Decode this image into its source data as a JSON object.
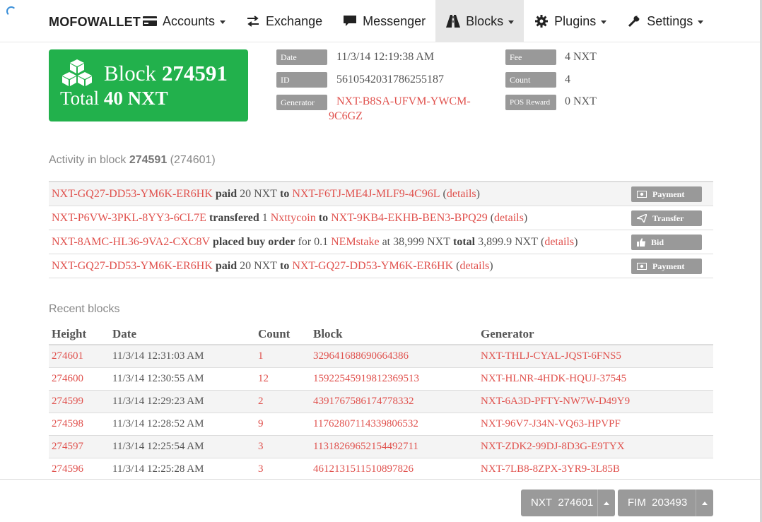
{
  "brand": "MOFOWALLET",
  "nav": [
    {
      "label": "Accounts",
      "icon": "card-icon",
      "dropdown": true
    },
    {
      "label": "Exchange",
      "icon": "exchange-icon",
      "dropdown": false
    },
    {
      "label": "Messenger",
      "icon": "chat-icon",
      "dropdown": false
    },
    {
      "label": "Blocks",
      "icon": "road-icon",
      "dropdown": true,
      "active": true
    },
    {
      "label": "Plugins",
      "icon": "gear-icon",
      "dropdown": true
    },
    {
      "label": "Settings",
      "icon": "wrench-icon",
      "dropdown": true
    }
  ],
  "block": {
    "word": "Block",
    "height": "274591",
    "total_word": "Total",
    "total": "40 NXT"
  },
  "info": {
    "date_label": "Date",
    "date_value": "11/3/14 12:19:38 AM",
    "id_label": "ID",
    "id_value": "5610542031786255187",
    "generator_label": "Generator",
    "generator_line1": "NXT-B8SA-UFVM-YWCM-",
    "generator_line2": "9C6GZ",
    "fee_label": "Fee",
    "fee_value": "4 NXT",
    "count_label": "Count",
    "count_value": "4",
    "pos_label": "POS Reward",
    "pos_value": "0 NXT"
  },
  "activity": {
    "title_prefix": "Activity in block",
    "block": "274591",
    "paren": "(274601)",
    "rows": [
      {
        "from": "NXT-GQ27-DD53-YM6K-ER6HK",
        "verb": "paid",
        "amount": "20 NXT",
        "to_word": "to",
        "to": "NXT-F6TJ-ME4J-MLF9-4C96L",
        "details": "details",
        "badge": "Payment",
        "badge_icon": "money-icon"
      },
      {
        "from": "NXT-P6VW-3PKL-8YY3-6CL7E",
        "verb": "transfered",
        "qty": "1",
        "asset": "Nxttycoin",
        "to_word": "to",
        "to": "NXT-9KB4-EKHB-BEN3-BPQ29",
        "details": "details",
        "badge": "Transfer",
        "badge_icon": "send-icon"
      },
      {
        "from": "NXT-8AMC-HL36-9VA2-CXC8V",
        "verb": "placed buy order",
        "for_text": "for 0.1",
        "asset": "NEMstake",
        "price_text": "at 38,999 NXT",
        "total_word": "total",
        "total_text": "3,899.9 NXT",
        "details": "details",
        "badge": "Bid",
        "badge_icon": "thumbs-up-icon"
      },
      {
        "from": "NXT-GQ27-DD53-YM6K-ER6HK",
        "verb": "paid",
        "amount": "20 NXT",
        "to_word": "to",
        "to": "NXT-GQ27-DD53-YM6K-ER6HK",
        "details": "details",
        "badge": "Payment",
        "badge_icon": "money-icon"
      }
    ]
  },
  "recent": {
    "title": "Recent blocks",
    "columns": [
      "Height",
      "Date",
      "Count",
      "Block",
      "Generator"
    ],
    "rows": [
      {
        "height": "274601",
        "date": "11/3/14 12:31:03 AM",
        "count": "1",
        "block": "329641688690664386",
        "generator": "NXT-THLJ-CYAL-JQST-6FNS5"
      },
      {
        "height": "274600",
        "date": "11/3/14 12:30:55 AM",
        "count": "12",
        "block": "15922545919812369513",
        "generator": "NXT-HLNR-4HDK-HQUJ-37545"
      },
      {
        "height": "274599",
        "date": "11/3/14 12:29:23 AM",
        "count": "2",
        "block": "4391767586174778332",
        "generator": "NXT-6A3D-PFTY-NW7W-D49Y9"
      },
      {
        "height": "274598",
        "date": "11/3/14 12:28:52 AM",
        "count": "9",
        "block": "11762807114339806532",
        "generator": "NXT-96V7-J34N-VQ63-HPVPF"
      },
      {
        "height": "274597",
        "date": "11/3/14 12:25:54 AM",
        "count": "3",
        "block": "11318269652154492711",
        "generator": "NXT-ZDK2-99DJ-8D3G-E9TYX"
      },
      {
        "height": "274596",
        "date": "11/3/14 12:25:28 AM",
        "count": "3",
        "block": "4612131511510897826",
        "generator": "NXT-7LB8-8ZPX-3YR9-3L85B"
      }
    ]
  },
  "footer": {
    "nxt_label": "NXT",
    "nxt_height": "274601",
    "fim_label": "FIM",
    "fim_height": "203493"
  },
  "colors": {
    "accent_green": "#22b14c",
    "link_red": "#e0514d",
    "badge_gray": "#999999"
  }
}
